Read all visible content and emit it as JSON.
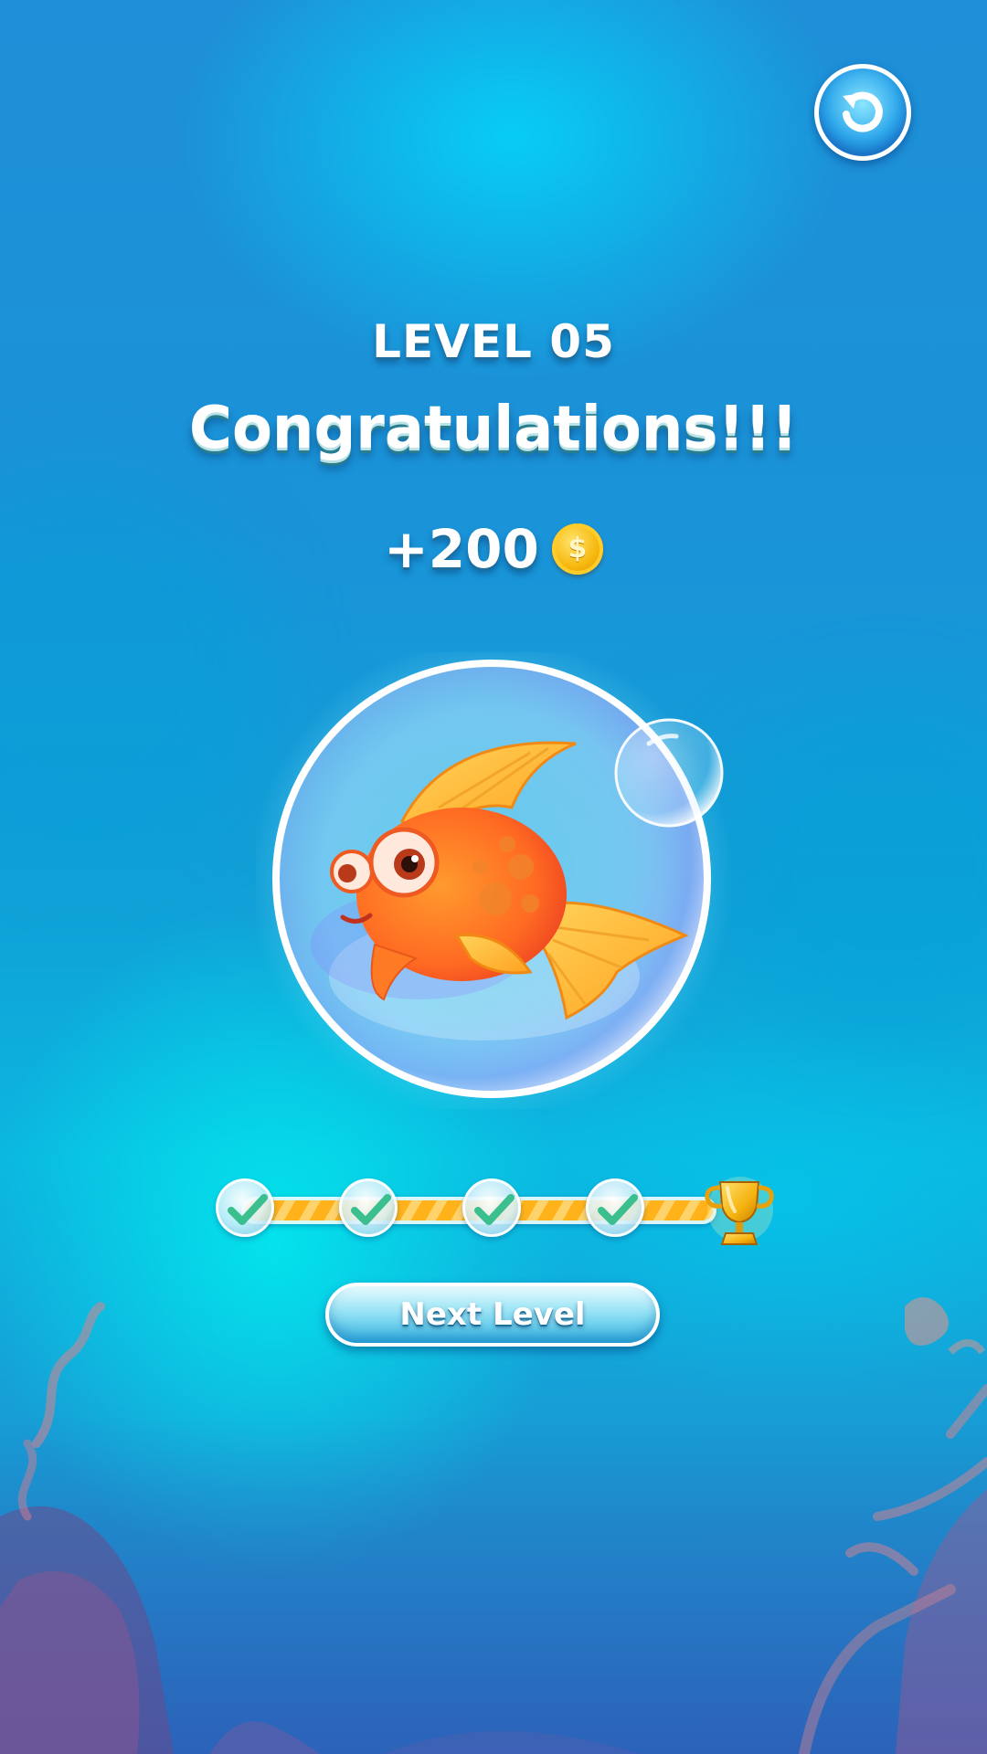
{
  "header": {
    "level_label": "LEVEL 05",
    "message": "Congratulations!!!"
  },
  "reward": {
    "amount": "+200",
    "currency_icon": "coin-icon",
    "coin_symbol": "$"
  },
  "progress": {
    "steps_completed": 4,
    "steps_total": 4,
    "goal_icon": "trophy-icon"
  },
  "actions": {
    "reset_icon": "reset-icon",
    "next_level_label": "Next Level"
  },
  "colors": {
    "background": "#1a93d8",
    "accent_gold": "#f7b90f",
    "progress_fill": "#ffb21a",
    "check_green": "#3bbf8f"
  }
}
